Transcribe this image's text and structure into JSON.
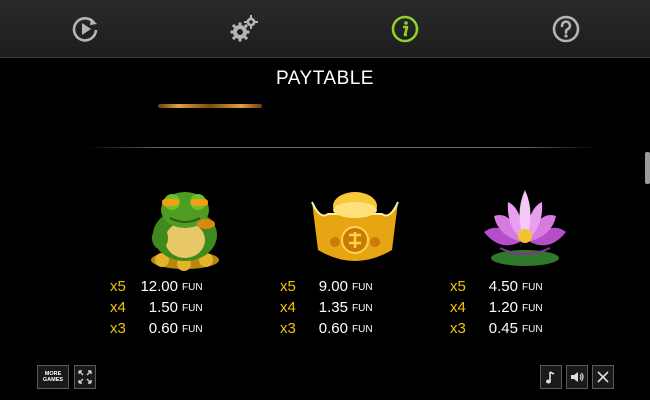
{
  "nav": {
    "items": [
      {
        "name": "autoplay",
        "icon": "replay-play-icon"
      },
      {
        "name": "settings",
        "icon": "gears-icon"
      },
      {
        "name": "info",
        "icon": "info-icon",
        "active": true
      },
      {
        "name": "help",
        "icon": "question-icon"
      }
    ],
    "active_color": "#8fd12a",
    "icon_color": "#b5b5b5"
  },
  "page": {
    "title": "PAYTABLE"
  },
  "symbols": [
    {
      "name": "frog",
      "icon": "golden-frog-icon",
      "pays": [
        {
          "mult": "x5",
          "amount": "12.00",
          "currency": "FUN"
        },
        {
          "mult": "x4",
          "amount": "1.50",
          "currency": "FUN"
        },
        {
          "mult": "x3",
          "amount": "0.60",
          "currency": "FUN"
        }
      ]
    },
    {
      "name": "gold-ingot",
      "icon": "gold-ingot-icon",
      "pays": [
        {
          "mult": "x5",
          "amount": "9.00",
          "currency": "FUN"
        },
        {
          "mult": "x4",
          "amount": "1.35",
          "currency": "FUN"
        },
        {
          "mult": "x3",
          "amount": "0.60",
          "currency": "FUN"
        }
      ]
    },
    {
      "name": "lotus",
      "icon": "lotus-flower-icon",
      "pays": [
        {
          "mult": "x5",
          "amount": "4.50",
          "currency": "FUN"
        },
        {
          "mult": "x4",
          "amount": "1.20",
          "currency": "FUN"
        },
        {
          "mult": "x3",
          "amount": "0.45",
          "currency": "FUN"
        }
      ]
    }
  ],
  "footer": {
    "more_games_line1": "MORE",
    "more_games_line2": "GAMES",
    "icons": [
      "fullscreen-icon",
      "music-note-icon",
      "speaker-icon",
      "close-icon"
    ]
  },
  "colors": {
    "multiplier": "#f4c400",
    "background": "#000000"
  }
}
